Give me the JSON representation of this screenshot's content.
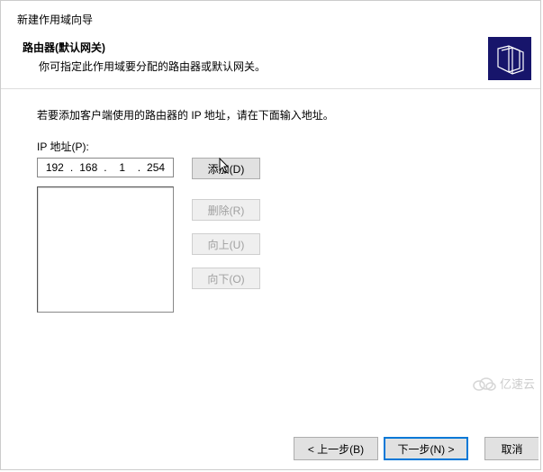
{
  "wizard": {
    "title": "新建作用域向导",
    "section_heading": "路由器(默认网关)",
    "section_desc": "你可指定此作用域要分配的路由器或默认网关。"
  },
  "content": {
    "instruction": "若要添加客户端使用的路由器的 IP 地址，请在下面输入地址。",
    "ip_label": "IP 地址(P):",
    "ip": {
      "o1": "192",
      "o2": "168",
      "o3": "1",
      "o4": "254"
    }
  },
  "buttons": {
    "add": "添加(D)",
    "remove": "删除(R)",
    "up": "向上(U)",
    "down": "向下(O)"
  },
  "footer": {
    "back": "< 上一步(B)",
    "next": "下一步(N) >",
    "cancel": "取消"
  },
  "watermark": "亿速云"
}
